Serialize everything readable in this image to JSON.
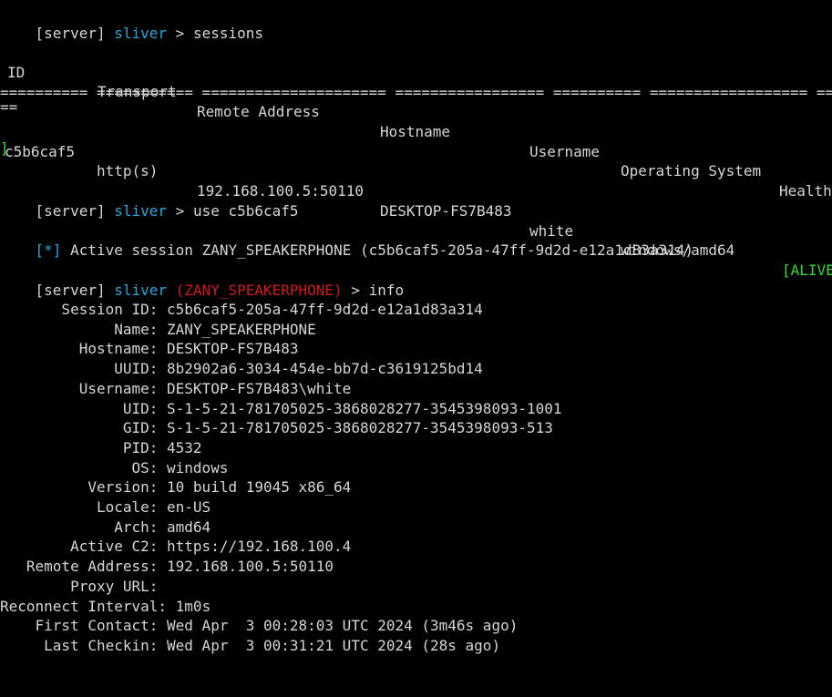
{
  "prompt": {
    "server": "[server]",
    "app": "sliver",
    "arrow": ">",
    "session_name": "(ZANY_SPEAKERPHONE)"
  },
  "commands": {
    "sessions": "sessions",
    "use": "use c5b6caf5",
    "info": "info"
  },
  "sessions_table": {
    "headers": [
      "ID",
      "Transport",
      "Remote Address",
      "Hostname",
      "Username",
      "Operating System",
      "Health"
    ],
    "separator": "========== =========== ===================== ================= ========== ================== ========",
    "separator_wrap": "==",
    "row": [
      "c5b6caf5",
      "http(s)",
      "192.168.100.5:50110",
      "DESKTOP-FS7B483",
      "white",
      "windows/amd64",
      "[ALIVE"
    ],
    "row_wrap": "]"
  },
  "active_session": {
    "marker": "[*]",
    "text": "Active session ZANY_SPEAKERPHONE (c5b6caf5-205a-47ff-9d2d-e12a1d83a314)"
  },
  "info": [
    {
      "label": "       Session ID:",
      "value": " c5b6caf5-205a-47ff-9d2d-e12a1d83a314"
    },
    {
      "label": "             Name:",
      "value": " ZANY_SPEAKERPHONE"
    },
    {
      "label": "         Hostname:",
      "value": " DESKTOP-FS7B483"
    },
    {
      "label": "             UUID:",
      "value": " 8b2902a6-3034-454e-bb7d-c3619125bd14"
    },
    {
      "label": "         Username:",
      "value": " DESKTOP-FS7B483\\white"
    },
    {
      "label": "              UID:",
      "value": " S-1-5-21-781705025-3868028277-3545398093-1001"
    },
    {
      "label": "              GID:",
      "value": " S-1-5-21-781705025-3868028277-3545398093-513"
    },
    {
      "label": "              PID:",
      "value": " 4532"
    },
    {
      "label": "               OS:",
      "value": " windows"
    },
    {
      "label": "          Version:",
      "value": " 10 build 19045 x86_64"
    },
    {
      "label": "           Locale:",
      "value": " en-US"
    },
    {
      "label": "             Arch:",
      "value": " amd64"
    },
    {
      "label": "        Active C2:",
      "value": " https://192.168.100.4"
    },
    {
      "label": "   Remote Address:",
      "value": " 192.168.100.5:50110"
    },
    {
      "label": "        Proxy URL:",
      "value": ""
    },
    {
      "label": "Reconnect Interval:",
      "value": " 1m0s"
    },
    {
      "label": "    First Contact:",
      "value": " Wed Apr  3 00:28:03 UTC 2024 (3m46s ago)"
    },
    {
      "label": "     Last Checkin:",
      "value": " Wed Apr  3 00:31:21 UTC 2024 (28s ago)"
    }
  ],
  "colors": {
    "background": "#000000",
    "text": "#d6d6d6",
    "app": "#2aa7d8",
    "session": "#d11a1a",
    "alive": "#2fdc2f"
  }
}
